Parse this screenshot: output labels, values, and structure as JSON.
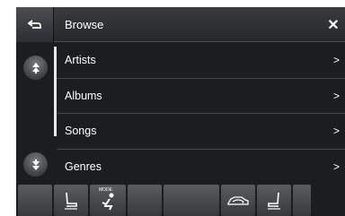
{
  "header": {
    "title": "Browse",
    "back_icon": "back-arrow-icon",
    "close_icon": "close-icon"
  },
  "scroll": {
    "up_icon": "scroll-up-icon",
    "down_icon": "scroll-down-icon"
  },
  "list": {
    "items": [
      {
        "label": "Artists",
        "arrow": ">"
      },
      {
        "label": "Albums",
        "arrow": ">"
      },
      {
        "label": "Songs",
        "arrow": ">"
      },
      {
        "label": "Genres",
        "arrow": ">"
      }
    ]
  },
  "bottombar": {
    "mode_label": "MODE",
    "icons": [
      "blank",
      "seat-icon",
      "airflow-mode-icon",
      "blank",
      "blank",
      "recirculation-car-icon",
      "seat-icon",
      "blank"
    ]
  },
  "colors": {
    "background": "#1c1d20",
    "text": "#ffffff",
    "divider": "#45474b"
  }
}
